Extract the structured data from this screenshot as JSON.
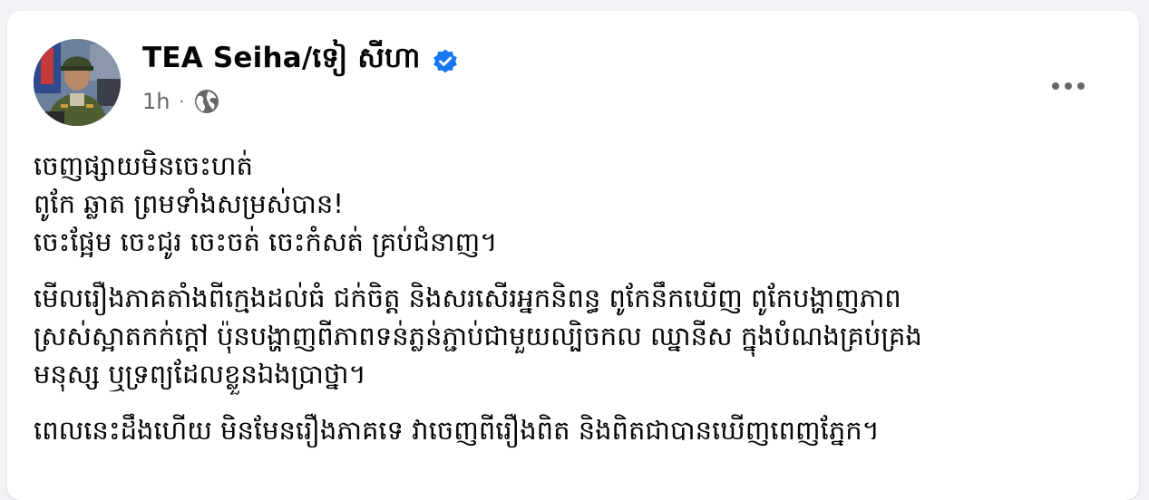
{
  "post": {
    "author_name": "TEA Seiha/ទៀ សីហា",
    "verified_icon": "verified-badge-icon",
    "time": "1h",
    "separator": "·",
    "audience_icon": "globe-icon",
    "more_icon": "more-options-icon",
    "paragraphs": [
      {
        "lines": [
          "ចេញផ្សាយមិនចេះហត់",
          "ពូកែ ឆ្លាត ព្រមទាំងសម្រស់បាន!",
          "ចេះផ្អែម ចេះជូរ ចេះចត់ ចេះកំសត់ គ្រប់ជំនាញ។"
        ]
      },
      {
        "lines": [
          "មើលរឿងភាគតាំងពីក្មេងដល់ធំ ជក់ចិត្ត និងសរសើរអ្នកនិពន្ធ ពូកែនឹកឃើញ ពូកែបង្ហាញភាព",
          "ស្រស់ស្អាតកក់ក្តៅ ប៉ុនបង្ហាញពីភាពទន់ភ្លន់ភ្ជាប់ជាមួយល្បិចកល ឈ្នានីស ក្នុងបំណងគ្រប់គ្រង",
          "មនុស្ស ឬទ្រព្យដែលខ្លួនឯងប្រាថ្នា។"
        ]
      },
      {
        "lines": [
          "ពេលនេះដឹងហើយ មិនមែនរឿងភាគទេ វាចេញពីរឿងពិត និងពិតជាបានឃើញពេញភ្នែក។"
        ]
      }
    ]
  },
  "colors": {
    "background": "#f0f2f5",
    "card": "#ffffff",
    "text_primary": "#050505",
    "text_secondary": "#65676b",
    "verified_blue": "#1877f2"
  }
}
